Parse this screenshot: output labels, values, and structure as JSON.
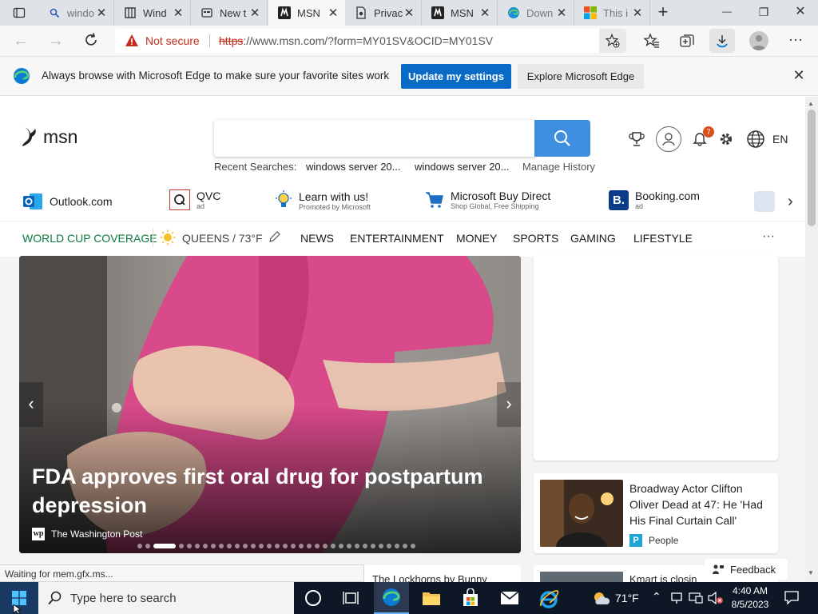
{
  "tabs": [
    {
      "title": "windo",
      "icon": "search-icon",
      "active": false
    },
    {
      "title": "Wind",
      "icon": "book-icon",
      "active": false
    },
    {
      "title": "New t",
      "icon": "newtab-icon",
      "active": false
    },
    {
      "title": "MSN",
      "icon": "msn-icon",
      "active": true
    },
    {
      "title": "Privac",
      "icon": "privacy-icon",
      "active": false
    },
    {
      "title": "MSN",
      "icon": "msn-icon",
      "active": false
    },
    {
      "title": "Down",
      "icon": "edge-icon",
      "active": false
    },
    {
      "title": "This i",
      "icon": "microsoft-icon",
      "active": false
    }
  ],
  "window": {
    "new_tab": "+",
    "minimize": "—",
    "maximize": "❐",
    "close": "✕"
  },
  "address": {
    "security": "Not secure",
    "scheme": "https",
    "rest": "://www.msn.com/?form=MY01SV&OCID=MY01SV"
  },
  "infobar": {
    "message": "Always browse with Microsoft Edge to make sure your favorite sites work",
    "primary_button": "Update my settings",
    "secondary_button": "Explore Microsoft Edge"
  },
  "msn": {
    "logo_text": "msn",
    "recent_label": "Recent Searches:",
    "recent": [
      "windows server 20...",
      "windows server 20..."
    ],
    "manage_history": "Manage History",
    "notification_count": "7",
    "language": "EN"
  },
  "quicklinks": [
    {
      "label": "Outlook.com",
      "sub": ""
    },
    {
      "label": "QVC",
      "sub": "ad"
    },
    {
      "label": "Learn with us!",
      "sub": "Promoted by Microsoft"
    },
    {
      "label": "Microsoft Buy Direct",
      "sub": "Shop Global, Free Shipping"
    },
    {
      "label": "Booking.com",
      "sub": "ad"
    }
  ],
  "nav": {
    "world_cup": "WORLD CUP COVERAGE",
    "weather": "QUEENS / 73°F",
    "items": [
      "NEWS",
      "ENTERTAINMENT",
      "MONEY",
      "SPORTS",
      "GAMING",
      "LIFESTYLE"
    ],
    "more": "···"
  },
  "hero": {
    "headline": "FDA approves first oral drug for postpartum depression",
    "source": "The Washington Post",
    "dots_count": 33,
    "active_dot": 2
  },
  "side_story": {
    "headline": "Broadway Actor Clifton Oliver Dead at 47: He 'Had His Final Curtain Call'",
    "source": "People"
  },
  "bottom": {
    "left_partial": "The Lockhorns by Bunny",
    "right_partial": "Kmart is closin"
  },
  "feedback": "Feedback",
  "status": "Waiting for mem.gfx.ms...",
  "taskbar": {
    "search_placeholder": "Type here to search",
    "weather_temp": "71°F",
    "time": "4:40 AM",
    "date": "8/5/2023"
  },
  "colors": {
    "accent": "#2f7ed8",
    "edge_blue": "#0078d4",
    "world_cup_green": "#0d7a3e",
    "not_secure_red": "#c42b1c"
  }
}
